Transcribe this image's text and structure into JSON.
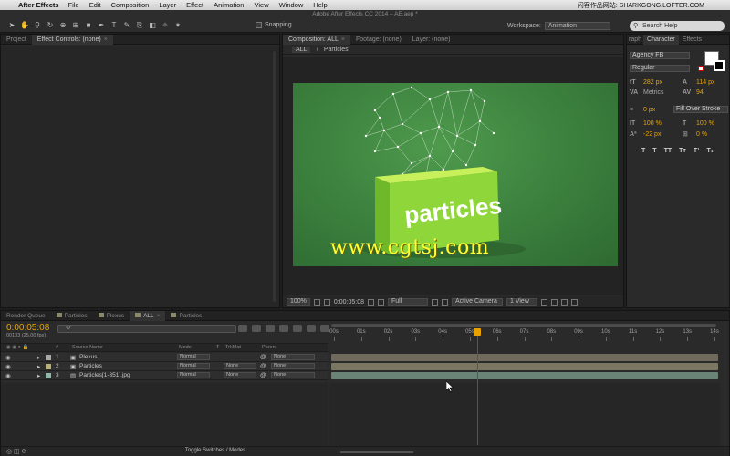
{
  "menubar": {
    "app": "After Effects",
    "items": [
      "File",
      "Edit",
      "Composition",
      "Layer",
      "Effect",
      "Animation",
      "View",
      "Window",
      "Help"
    ],
    "right": "闪客作品网站: SHARKGONG.LOFTER.COM"
  },
  "toolbar": {
    "doc_title": "Adobe After Effects CC 2014 – AE.aep *",
    "snapping": "Snapping",
    "workspace_label": "Workspace:",
    "workspace_value": "Animation",
    "search_placeholder": "Search Help"
  },
  "project_panel": {
    "tabs": [
      "Project",
      "Effect Controls: (none)"
    ]
  },
  "comp_panel": {
    "tabs": [
      "Composition: ALL",
      "Footage: (none)",
      "Layer: (none)"
    ],
    "breadcrumb": [
      "ALL",
      "Particles"
    ],
    "zoom": "100%",
    "timecode": "0:00:05:08",
    "resolution": "Full",
    "camera": "Active Camera",
    "views": "1 View",
    "box_text": "particles",
    "watermark": "www.cgtsj.com"
  },
  "char_panel": {
    "tabs": [
      "raph",
      "Character",
      "Effects"
    ],
    "font": "Agency FB",
    "style": "Regular",
    "font_size": "282 px",
    "leading": "114 px",
    "kerning": "Metrics",
    "tracking": "94",
    "stroke_width": "0 px",
    "stroke_mode": "Fill Over Stroke",
    "vscale": "100 %",
    "hscale": "100 %",
    "baseline": "-22 px",
    "tsume": "0 %",
    "colors": {
      "fill": "#ffffff",
      "stroke": "#000000"
    }
  },
  "timeline": {
    "tabs": [
      {
        "label": "Render Queue",
        "color": ""
      },
      {
        "label": "Particles",
        "color": "#8a8a6a"
      },
      {
        "label": "Plexus",
        "color": "#8a8a6a"
      },
      {
        "label": "ALL",
        "color": "#8a8a6a"
      },
      {
        "label": "Particles",
        "color": "#8a8a6a"
      }
    ],
    "timecode": "0:00:05:08",
    "frames": "00133 (25.00 fps)",
    "columns": [
      "#",
      "Source Name",
      "Mode",
      "T",
      "TrkMat",
      "Parent"
    ],
    "layers": [
      {
        "num": "1",
        "name": "Plexus",
        "mode": "Normal",
        "trkmat": "",
        "parent": "None",
        "label_color": "#a9a9a9",
        "bar_color": "#6f6a5c"
      },
      {
        "num": "2",
        "name": "Particles",
        "mode": "Normal",
        "trkmat": "None",
        "parent": "None",
        "label_color": "#b8b07a",
        "bar_color": "#7b7661"
      },
      {
        "num": "3",
        "name": "Particles[1-351].jpg",
        "mode": "Normal",
        "trkmat": "None",
        "parent": "None",
        "label_color": "#8fb8a8",
        "bar_color": "#6a8478"
      }
    ],
    "ruler_labels": [
      "00s",
      "01s",
      "02s",
      "03s",
      "04s",
      "05s",
      "06s",
      "07s",
      "08s",
      "09s",
      "10s",
      "11s",
      "12s",
      "13s",
      "14s"
    ],
    "duration_seconds": 14,
    "current_seconds": 5.32,
    "footer": "Toggle Switches / Modes"
  }
}
